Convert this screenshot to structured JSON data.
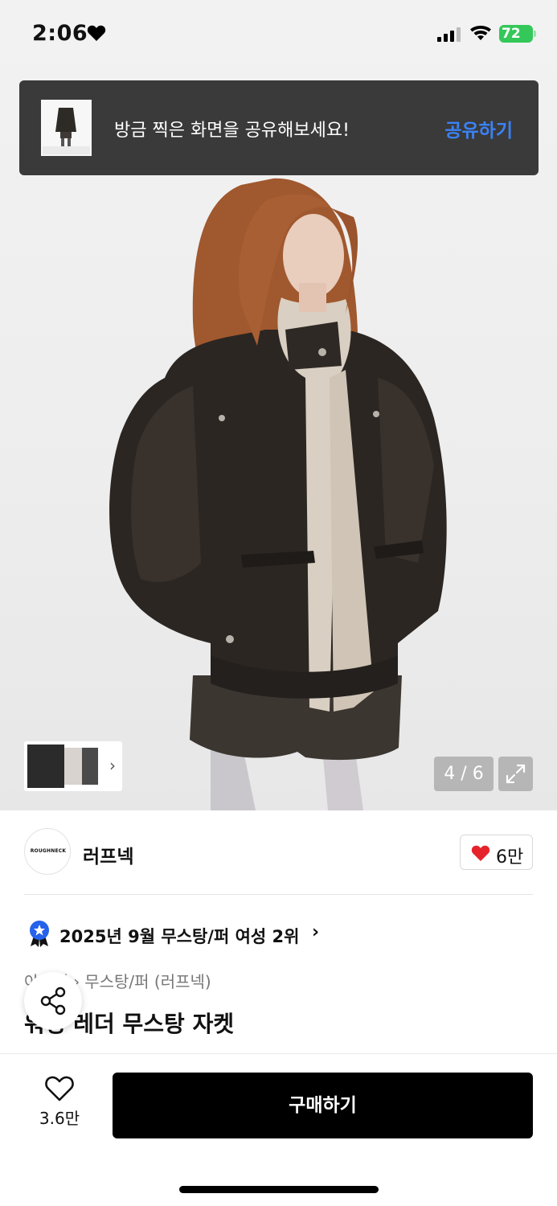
{
  "status_bar": {
    "time": "2:06",
    "battery": "72"
  },
  "toast": {
    "message": "방금 찍은 화면을 공유해보세요!",
    "action_label": "공유하기"
  },
  "gallery": {
    "counter": "4 / 6"
  },
  "brand": {
    "logo_text": "ROUGHNECK",
    "name": "러프넥",
    "like_count": "6만"
  },
  "ranking": {
    "text": "2025년 9월 무스탕/퍼 여성 2위"
  },
  "breadcrumb": {
    "first": "아우터",
    "second": "무스탕/퍼 (러프넥)"
  },
  "product": {
    "title": "워싱 레더 무스탕 자켓"
  },
  "bottom_bar": {
    "wish_count": "3.6만",
    "buy_label": "구매하기"
  },
  "colors": {
    "accent_blue": "#3b82f6",
    "like_red": "#e5232b",
    "battery_green": "#34c759"
  }
}
